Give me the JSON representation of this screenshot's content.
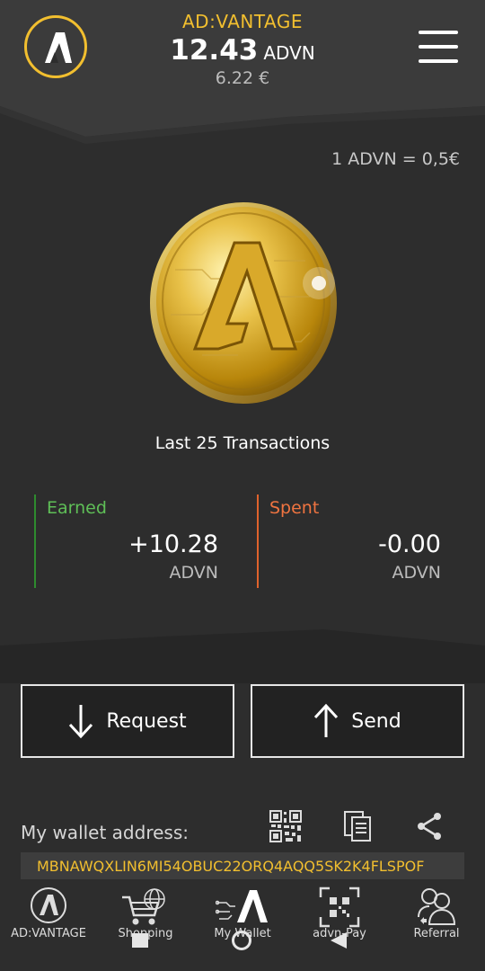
{
  "header": {
    "brand": "AD:VANTAGE",
    "balance": "12.43",
    "balance_unit": "ADVN",
    "balance_eur": "6.22 €"
  },
  "rate": "1 ADVN = 0,5€",
  "summary": {
    "title": "Last 25 Transactions",
    "earned": {
      "label": "Earned",
      "value": "+10.28",
      "unit": "ADVN"
    },
    "spent": {
      "label": "Spent",
      "value": "-0.00",
      "unit": "ADVN"
    }
  },
  "actions": {
    "request": "Request",
    "send": "Send"
  },
  "wallet": {
    "label": "My wallet address:",
    "address": "MBNAWQXLIN6MI54OBUC22ORQ4AQQ5SK2K4FLSPOF"
  },
  "nav": [
    {
      "label": "AD:VANTAGE",
      "icon": "advantage-logo-icon"
    },
    {
      "label": "Shopping",
      "icon": "shopping-cart-icon"
    },
    {
      "label": "My Wallet",
      "icon": "wallet-icon"
    },
    {
      "label": "advn-Pay",
      "icon": "qr-scan-icon"
    },
    {
      "label": "Referral",
      "icon": "referral-icon"
    }
  ],
  "colors": {
    "accent": "#f2bf2f",
    "earned": "#5fbf57",
    "spent": "#f07440",
    "background": "#2d2d2d"
  }
}
